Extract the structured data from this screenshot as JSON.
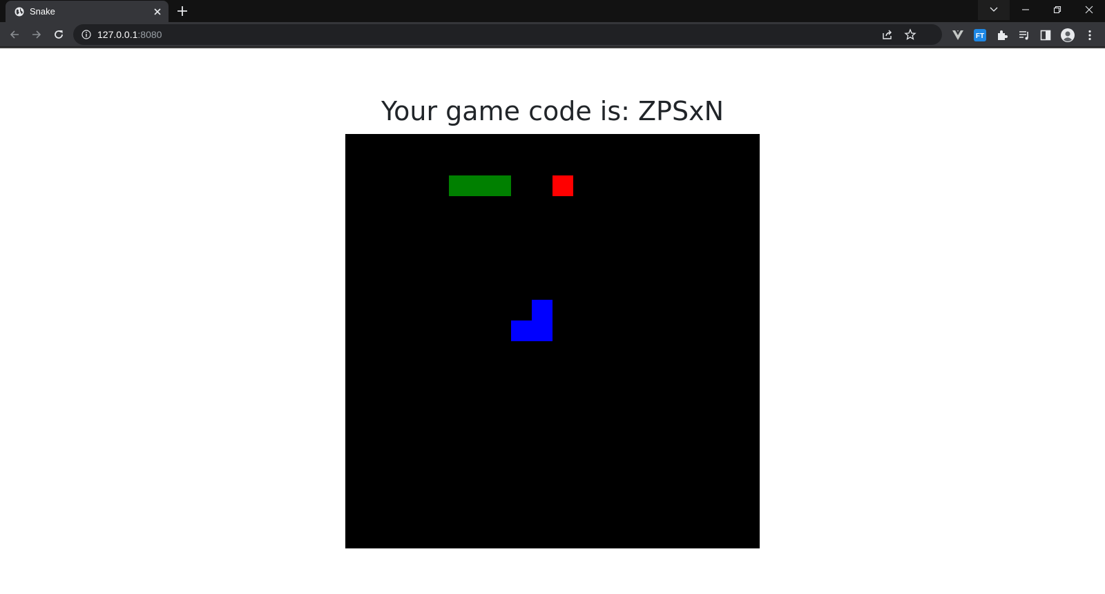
{
  "browser": {
    "tab": {
      "title": "Snake"
    },
    "url": {
      "host": "127.0.0.1",
      "port": ":8080"
    }
  },
  "page": {
    "title": "Your game code is: ZPSxN"
  },
  "game": {
    "grid_size": 20,
    "colors": {
      "board": "#000000",
      "snake_one": "#008000",
      "snake_two": "#0000ff",
      "food": "#ff0000"
    },
    "snake_one": [
      [
        5,
        2
      ],
      [
        6,
        2
      ],
      [
        7,
        2
      ]
    ],
    "snake_two": [
      [
        8,
        9
      ],
      [
        9,
        9
      ],
      [
        9,
        8
      ]
    ],
    "food": [
      10,
      2
    ]
  }
}
